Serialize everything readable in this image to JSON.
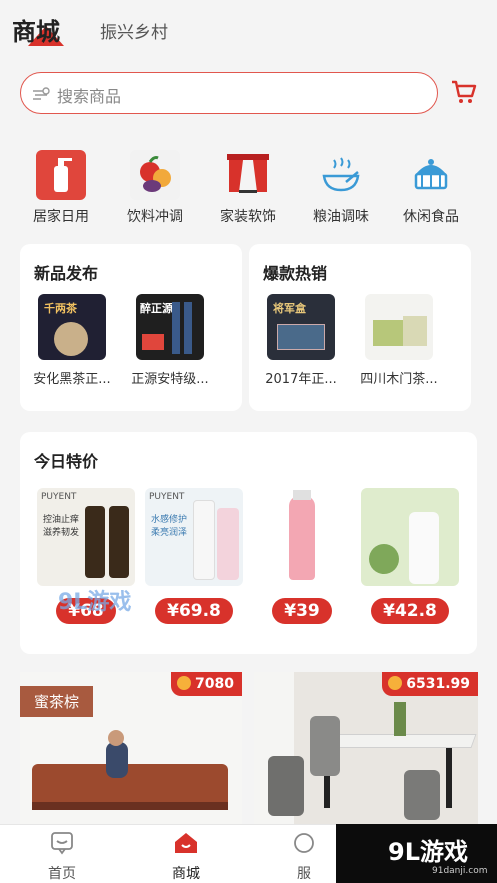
{
  "top_tabs": {
    "active": "商城",
    "other": "振兴乡村"
  },
  "search": {
    "placeholder": "搜索商品"
  },
  "categories": [
    {
      "label": "居家日用",
      "icon": "lotion-bottle-icon"
    },
    {
      "label": "饮料冲调",
      "icon": "fruit-icon"
    },
    {
      "label": "家装软饰",
      "icon": "curtain-icon"
    },
    {
      "label": "粮油调味",
      "icon": "bowl-icon"
    },
    {
      "label": "休闲食品",
      "icon": "cake-icon"
    }
  ],
  "new_products": {
    "title": "新品发布",
    "items": [
      {
        "name": "安化黑茶正...",
        "thumb_text": "千两茶"
      },
      {
        "name": "正源安特级...",
        "thumb_text": "醉正源"
      }
    ]
  },
  "hot_sales": {
    "title": "爆款热销",
    "items": [
      {
        "name": "2017年正...",
        "thumb_text": "将军盒"
      },
      {
        "name": "四川木门茶...",
        "thumb_text": ""
      }
    ]
  },
  "daily_deals": {
    "title": "今日特价",
    "items": [
      {
        "price": "¥68",
        "brand": "PUYENT",
        "tagline": "控油止痒 滋养韧发"
      },
      {
        "price": "¥69.8",
        "brand": "PUYENT",
        "tagline": "水感修护 柔亮润泽"
      },
      {
        "price": "¥39",
        "brand": "",
        "tagline": ""
      },
      {
        "price": "¥42.8",
        "brand": "",
        "tagline": ""
      }
    ]
  },
  "banners": [
    {
      "tag": "蜜茶棕",
      "price": "7080",
      "caption": ""
    },
    {
      "tag": "",
      "price": "6531.99"
    }
  ],
  "bottom_nav": [
    {
      "label": "首页",
      "icon": "home-chat-icon"
    },
    {
      "label": "商城",
      "icon": "shop-house-icon"
    },
    {
      "label": "服",
      "icon": "service-icon"
    }
  ],
  "watermarks": {
    "logo_text": "9L游戏",
    "small_text": "91danji.com"
  },
  "colors": {
    "accent": "#d8322b",
    "search_border": "#e1574e"
  }
}
